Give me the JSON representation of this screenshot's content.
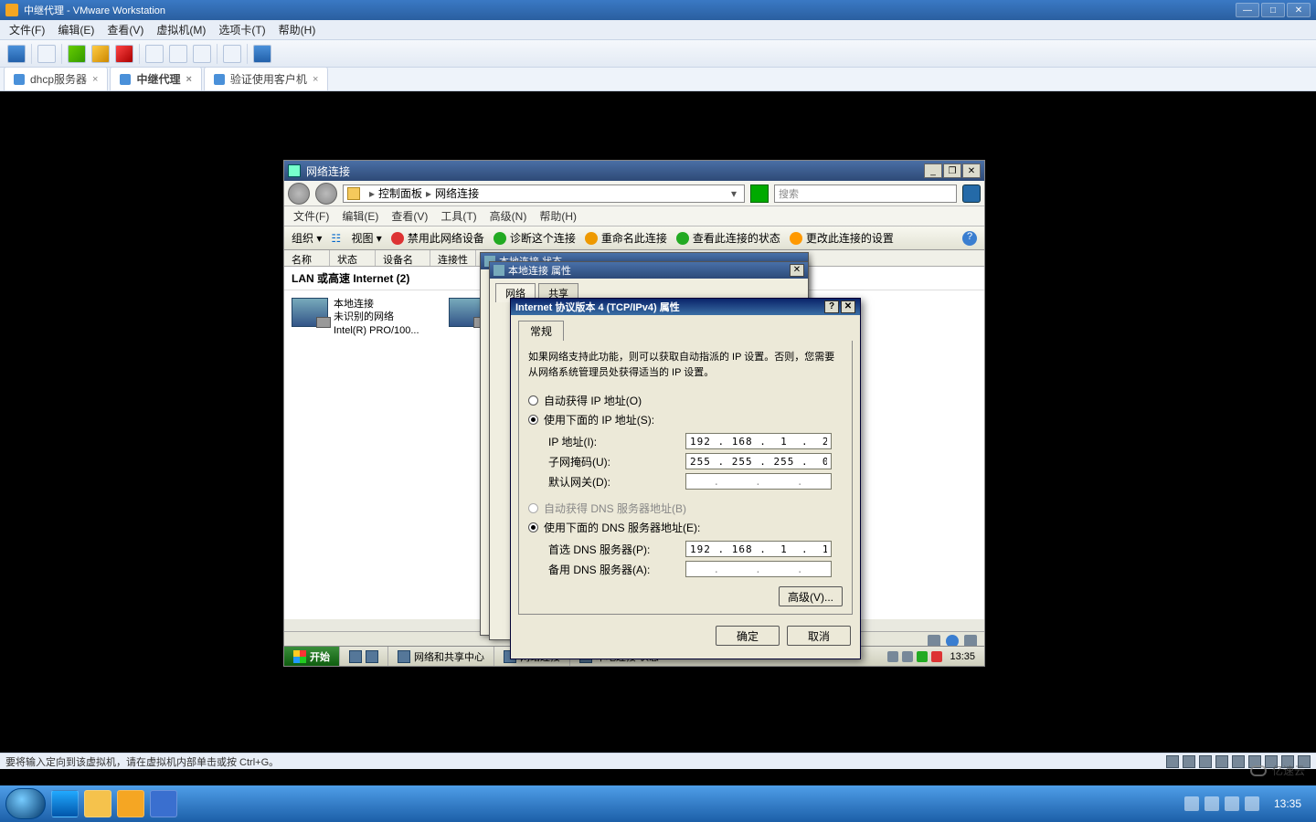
{
  "vmware": {
    "title": "中继代理 - VMware Workstation",
    "menu": [
      "文件(F)",
      "编辑(E)",
      "查看(V)",
      "虚拟机(M)",
      "选项卡(T)",
      "帮助(H)"
    ],
    "tabs": [
      {
        "label": "dhcp服务器",
        "active": false
      },
      {
        "label": "中继代理",
        "active": true
      },
      {
        "label": "验证使用客户机",
        "active": false
      }
    ],
    "status_text": "要将输入定向到该虚拟机，请在虚拟机内部单击或按 Ctrl+G。"
  },
  "network_window": {
    "title": "网络连接",
    "breadcrumb": {
      "root": "控制面板",
      "leaf": "网络连接"
    },
    "search_placeholder": "搜索",
    "menu": [
      "文件(F)",
      "编辑(E)",
      "查看(V)",
      "工具(T)",
      "高级(N)",
      "帮助(H)"
    ],
    "toolbar": {
      "organize": "组织 ▾",
      "view": "视图 ▾",
      "disable": "禁用此网络设备",
      "diagnose": "诊断这个连接",
      "rename": "重命名此连接",
      "status": "查看此连接的状态",
      "change": "更改此连接的设置"
    },
    "columns": [
      "名称",
      "状态",
      "设备名",
      "连接性"
    ],
    "category": "LAN 或高速 Internet (2)",
    "connection": {
      "name": "本地连接",
      "status": "未识别的网络",
      "device": "Intel(R) PRO/100..."
    }
  },
  "status_popup": {
    "title": "本地连接 状态"
  },
  "prop_sheet": {
    "title": "本地连接 属性",
    "tabs": [
      "网络",
      "共享"
    ]
  },
  "tcp_dialog": {
    "title": "Internet 协议版本 4 (TCP/IPv4) 属性",
    "tab": "常规",
    "description": "如果网络支持此功能，则可以获取自动指派的 IP 设置。否则，您需要从网络系统管理员处获得适当的 IP 设置。",
    "radio_auto_ip": "自动获得 IP 地址(O)",
    "radio_manual_ip": "使用下面的 IP 地址(S):",
    "labels": {
      "ip": "IP 地址(I):",
      "mask": "子网掩码(U):",
      "gateway": "默认网关(D):",
      "prefdns": "首选 DNS 服务器(P):",
      "altdns": "备用 DNS 服务器(A):"
    },
    "values": {
      "ip": "192 . 168 .  1  .  2",
      "mask": "255 . 255 . 255 .  0",
      "gateway": " .     .     . ",
      "prefdns": "192 . 168 .  1  .  1|",
      "altdns": " .     .     . "
    },
    "radio_auto_dns": "自动获得 DNS 服务器地址(B)",
    "radio_manual_dns": "使用下面的 DNS 服务器地址(E):",
    "advanced": "高级(V)...",
    "ok": "确定",
    "cancel": "取消"
  },
  "inner_taskbar": {
    "start": "开始",
    "items": [
      "网络和共享中心",
      "网络连接",
      "本地连接 状态"
    ],
    "clock": "13:35"
  },
  "host": {
    "time": "13:35",
    "date": ""
  },
  "watermark": "亿速云"
}
